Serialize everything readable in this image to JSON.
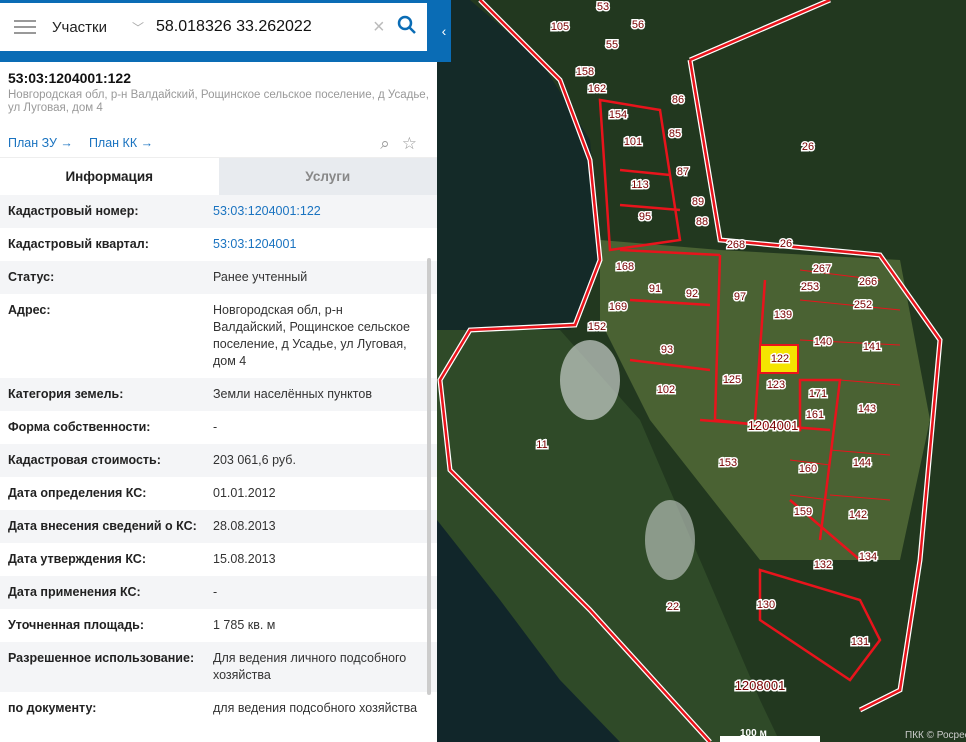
{
  "search": {
    "layer": "Участки",
    "query": "58.018326 33.262022"
  },
  "object": {
    "cadastral_number": "53:03:1204001:122",
    "address": "Новгородская обл, р-н Валдайский, Рощинское сельское поселение, д Усадье, ул Луговая, дом 4",
    "link_plan_zu": "План ЗУ →",
    "link_plan_kk": "План КК →"
  },
  "tabs": [
    {
      "label": "Информация"
    },
    {
      "label": "Услуги"
    }
  ],
  "rows": [
    {
      "label": "Кадастровый номер:",
      "value": "53:03:1204001:122"
    },
    {
      "label": "Кадастровый квартал:",
      "value": "53:03:1204001"
    },
    {
      "label": "Статус:",
      "value": "Ранее учтенный"
    },
    {
      "label": "Адрес:",
      "value": "Новгородская обл, р-н Валдайский, Рощинское сельское поселение, д Усадье, ул Луговая, дом 4"
    },
    {
      "label": "Категория земель:",
      "value": "Земли населённых пунктов"
    },
    {
      "label": "Форма собственности:",
      "value": "-"
    },
    {
      "label": "Кадастровая стоимость:",
      "value": "203 061,6 руб."
    },
    {
      "label": "Дата определения КС:",
      "value": "01.01.2012"
    },
    {
      "label": "Дата внесения сведений о КС:",
      "value": "28.08.2013"
    },
    {
      "label": "Дата утверждения КС:",
      "value": "15.08.2013"
    },
    {
      "label": "Дата применения КС:",
      "value": "-"
    },
    {
      "label": "Уточненная площадь:",
      "value": "1 785 кв. м"
    },
    {
      "label": "Разрешенное использование:",
      "value": "Для ведения личного подсобного хозяйства"
    },
    {
      "label": "по документу:",
      "value": "для ведения подсобного хозяйства"
    }
  ],
  "map": {
    "parcel_labels": [
      "105",
      "53",
      "56",
      "55",
      "158",
      "162",
      "86",
      "154",
      "85",
      "101",
      "87",
      "113",
      "89",
      "95",
      "88",
      "268",
      "26",
      "26",
      "267",
      "266",
      "253",
      "252",
      "168",
      "91",
      "92",
      "97",
      "139",
      "140",
      "141",
      "169",
      "152",
      "93",
      "122",
      "125",
      "123",
      "171",
      "143",
      "102",
      "161",
      "11",
      "153",
      "160",
      "144",
      "159",
      "142",
      "132",
      "134",
      "22",
      "130",
      "131"
    ],
    "quarter_labels": [
      "1204001",
      "1208001"
    ],
    "scale": "100 м",
    "attribution": "ПКК © Росреестр",
    "highlight_color": "#f5e400",
    "boundary_color": "#e8141c"
  }
}
